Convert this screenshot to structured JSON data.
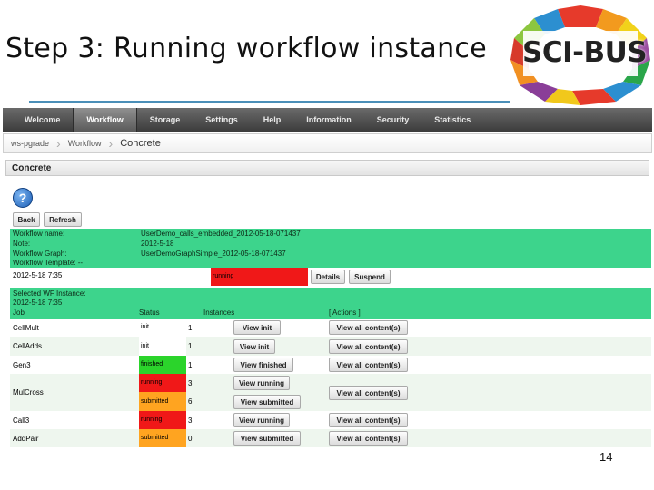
{
  "slide": {
    "title": "Step 3: Running workflow instance",
    "page_number": "14"
  },
  "logo": {
    "text": "SCI-BUS"
  },
  "menu": [
    {
      "label": "Welcome",
      "active": false
    },
    {
      "label": "Workflow",
      "active": true
    },
    {
      "label": "Storage",
      "active": false
    },
    {
      "label": "Settings",
      "active": false
    },
    {
      "label": "Help",
      "active": false
    },
    {
      "label": "Information",
      "active": false
    },
    {
      "label": "Security",
      "active": false
    },
    {
      "label": "Statistics",
      "active": false
    }
  ],
  "breadcrumb": [
    "ws-pgrade",
    "Workflow",
    "Concrete"
  ],
  "panel": {
    "title": "Concrete"
  },
  "buttons": {
    "back": "Back",
    "refresh": "Refresh",
    "details": "Details",
    "suspend": "Suspend"
  },
  "workflow_info": [
    {
      "label": "Workflow name:",
      "value": "UserDemo_calls_embedded_2012-05-18-071437"
    },
    {
      "label": "Note:",
      "value": "2012-5-18"
    },
    {
      "label": "Workflow Graph:",
      "value": "UserDemoGraphSimple_2012-05-18-071437"
    },
    {
      "label": "Workflow Template: --",
      "value": ""
    }
  ],
  "instance": {
    "date": "2012-5-18 7:35",
    "status": "running"
  },
  "selected": {
    "label": "Selected WF Instance:",
    "date": "2012-5-18 7:35"
  },
  "columns": {
    "job": "Job",
    "status": "Status",
    "instances": "Instances",
    "actions": "[ Actions ]"
  },
  "jobs": [
    {
      "name": "CellMult",
      "rows": [
        {
          "status": "init",
          "count": "1",
          "action": "View init"
        }
      ]
    },
    {
      "name": "CellAdds",
      "rows": [
        {
          "status": "init",
          "count": "1",
          "action": "View init"
        }
      ]
    },
    {
      "name": "Gen3",
      "rows": [
        {
          "status": "finished",
          "count": "1",
          "action": "View finished"
        }
      ]
    },
    {
      "name": "MulCross",
      "rows": [
        {
          "status": "running",
          "count": "3",
          "action": "View running"
        },
        {
          "status": "submitted",
          "count": "6",
          "action": "View submitted"
        }
      ]
    },
    {
      "name": "Call3",
      "rows": [
        {
          "status": "running",
          "count": "3",
          "action": "View running"
        }
      ]
    },
    {
      "name": "AddPair",
      "rows": [
        {
          "status": "submitted",
          "count": "0",
          "action": "View submitted"
        }
      ]
    }
  ],
  "view_all_label": "View all content(s)",
  "colors": {
    "green_bar": "#3dd48c",
    "running": "#f01818",
    "finished": "#2bd42b",
    "submitted": "#ffa420",
    "title_rule": "#4b8fb8"
  }
}
